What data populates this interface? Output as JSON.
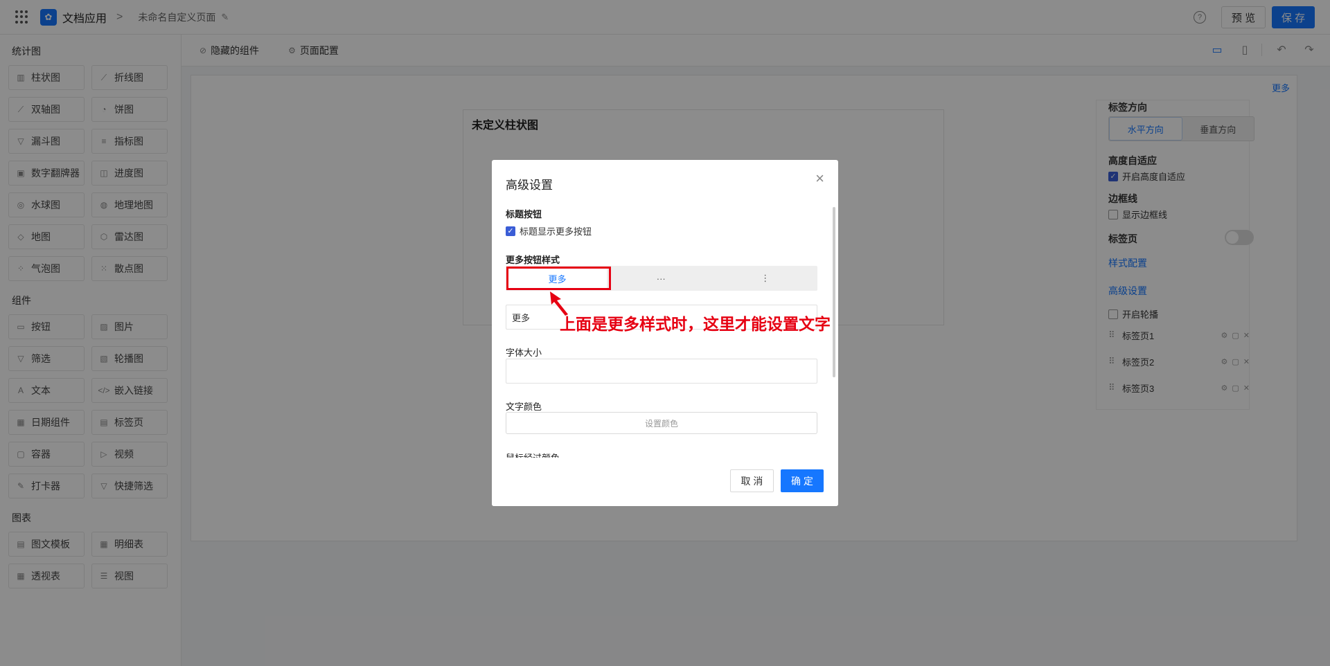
{
  "topbar": {
    "app_name": "文档应用",
    "crumb_sep": ">",
    "page_name": "未命名自定义页面",
    "help": "?",
    "preview_label": "预 览",
    "save_label": "保 存"
  },
  "sidebar": {
    "sections": [
      {
        "title": "统计图",
        "items": [
          {
            "label": "柱状图",
            "icon": "bar-chart-icon",
            "glyph": "▥"
          },
          {
            "label": "折线图",
            "icon": "line-chart-icon",
            "glyph": "⟋"
          },
          {
            "label": "双轴图",
            "icon": "dual-axis-icon",
            "glyph": "⟋"
          },
          {
            "label": "饼图",
            "icon": "pie-chart-icon",
            "glyph": "◔"
          },
          {
            "label": "漏斗图",
            "icon": "funnel-icon",
            "glyph": "▽"
          },
          {
            "label": "指标图",
            "icon": "metric-icon",
            "glyph": "≡"
          },
          {
            "label": "数字翻牌器",
            "icon": "number-flip-icon",
            "glyph": "▣"
          },
          {
            "label": "进度图",
            "icon": "progress-icon",
            "glyph": "◫"
          },
          {
            "label": "水球图",
            "icon": "liquid-icon",
            "glyph": "◎"
          },
          {
            "label": "地理地图",
            "icon": "geo-map-icon",
            "glyph": "◍"
          },
          {
            "label": "地图",
            "icon": "map-icon",
            "glyph": "◇"
          },
          {
            "label": "雷达图",
            "icon": "radar-icon",
            "glyph": "⬡"
          },
          {
            "label": "气泡图",
            "icon": "bubble-icon",
            "glyph": "⁘"
          },
          {
            "label": "散点图",
            "icon": "scatter-icon",
            "glyph": "⁙"
          }
        ]
      },
      {
        "title": "组件",
        "items": [
          {
            "label": "按钮",
            "icon": "button-icon",
            "glyph": "▭"
          },
          {
            "label": "图片",
            "icon": "image-icon",
            "glyph": "▨"
          },
          {
            "label": "筛选",
            "icon": "filter-icon",
            "glyph": "▽"
          },
          {
            "label": "轮播图",
            "icon": "carousel-icon",
            "glyph": "▧"
          },
          {
            "label": "文本",
            "icon": "text-icon",
            "glyph": "A"
          },
          {
            "label": "嵌入链接",
            "icon": "embed-link-icon",
            "glyph": "</>"
          },
          {
            "label": "日期组件",
            "icon": "calendar-icon",
            "glyph": "▦"
          },
          {
            "label": "标签页",
            "icon": "tabs-icon",
            "glyph": "▤"
          },
          {
            "label": "容器",
            "icon": "container-icon",
            "glyph": "▢"
          },
          {
            "label": "视频",
            "icon": "video-icon",
            "glyph": "▷"
          },
          {
            "label": "打卡器",
            "icon": "checkin-icon",
            "glyph": "✎"
          },
          {
            "label": "快捷筛选",
            "icon": "quick-filter-icon",
            "glyph": "▽"
          }
        ]
      },
      {
        "title": "图表",
        "items": [
          {
            "label": "图文模板",
            "icon": "template-icon",
            "glyph": "▤"
          },
          {
            "label": "明细表",
            "icon": "detail-table-icon",
            "glyph": "▦"
          },
          {
            "label": "透视表",
            "icon": "pivot-table-icon",
            "glyph": "▦"
          },
          {
            "label": "视图",
            "icon": "view-icon",
            "glyph": "☰"
          }
        ]
      }
    ]
  },
  "toolbar": {
    "hidden_components": "隐藏的组件",
    "page_config": "页面配置"
  },
  "canvas": {
    "more_link": "更多",
    "chart_title": "未定义柱状图"
  },
  "config_panel": {
    "label_direction": "标签方向",
    "dir_horizontal": "水平方向",
    "dir_vertical": "垂直方向",
    "auto_height": "高度自适应",
    "auto_height_cb": "开启高度自适应",
    "border": "边框线",
    "border_cb": "显示边框线",
    "tab_page": "标签页",
    "style_config": "样式配置",
    "advanced": "高级设置",
    "carousel_cb": "开启轮播",
    "tabs": [
      "标签页1",
      "标签页2",
      "标签页3"
    ]
  },
  "modal": {
    "title": "高级设置",
    "title_button": "标题按钮",
    "show_more_cb": "标题显示更多按钮",
    "more_style": "更多按钮样式",
    "styles": [
      "更多",
      "···",
      "⋮"
    ],
    "text_value": "更多",
    "font_size": "字体大小",
    "text_color": "文字颜色",
    "set_color": "设置颜色",
    "hover_color_cut": "鼠标经过颜色",
    "cancel": "取 消",
    "ok": "确 定"
  },
  "annotation": {
    "text": "上面是更多样式时，这里才能设置文字",
    "color": "#e60012"
  },
  "colors": {
    "primary": "#1677ff"
  }
}
